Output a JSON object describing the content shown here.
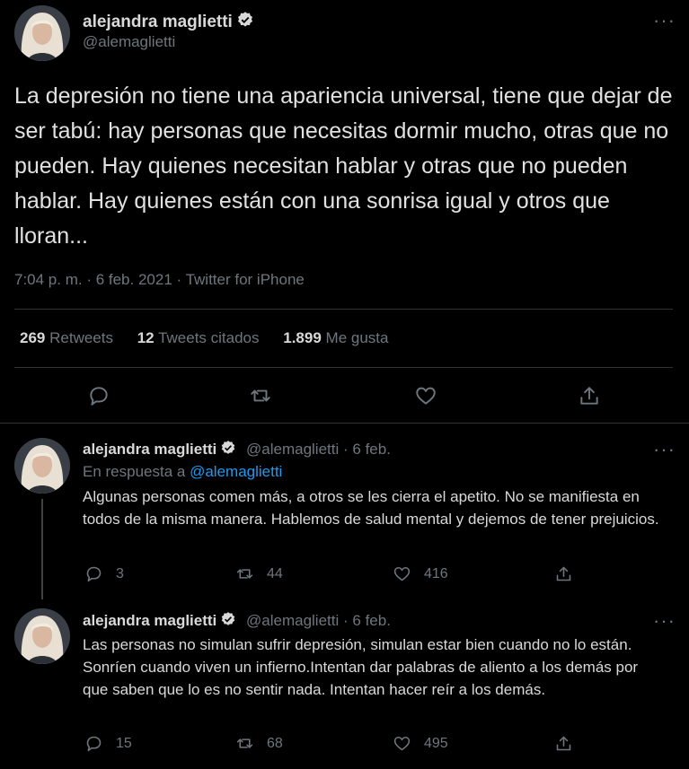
{
  "main_tweet": {
    "author_name": "alejandra maglietti",
    "author_handle": "@alemaglietti",
    "text": "La depresión no tiene una apariencia universal, tiene que dejar de ser tabú: hay personas que necesitas dormir mucho, otras que no pueden. Hay quienes necesitan hablar y otras que no pueden hablar. Hay quienes están con una sonrisa igual y otros que lloran...",
    "meta": "7:04 p. m. · 6 feb. 2021 · Twitter for iPhone",
    "stats": {
      "retweets_count": "269",
      "retweets_label": "Retweets",
      "quotes_count": "12",
      "quotes_label": "Tweets citados",
      "likes_count": "1.899",
      "likes_label": "Me gusta"
    },
    "icons": [
      "comment-icon",
      "retweet-icon",
      "heart-icon",
      "share-icon"
    ]
  },
  "replies": [
    {
      "author_name": "alejandra maglietti",
      "author_handle": "@alemaglietti",
      "separator": "·",
      "date": "6 feb.",
      "reply_prefix": "En respuesta a",
      "reply_to": "@alemaglietti",
      "text": "Algunas personas comen más, a otros se les cierra el apetito. No se manifiesta en todos de la misma manera. Hablemos de salud mental y dejemos de tener prejuicios.",
      "replies_count": "3",
      "retweets_count": "44",
      "likes_count": "416"
    },
    {
      "author_name": "alejandra maglietti",
      "author_handle": "@alemaglietti",
      "separator": "·",
      "date": "6 feb.",
      "text": "Las personas no simulan sufrir depresión, simulan estar bien cuando no lo están. Sonríen cuando viven un infierno.Intentan dar palabras de aliento a los demás por que saben que lo es no sentir nada. Intentan hacer reír a los demás.",
      "replies_count": "15",
      "retweets_count": "68",
      "likes_count": "495"
    }
  ],
  "colors": {
    "background": "#000000",
    "text": "#d9d9d9",
    "secondary": "#6e767d",
    "link": "#1d9bf0",
    "divider": "#2f3336"
  }
}
